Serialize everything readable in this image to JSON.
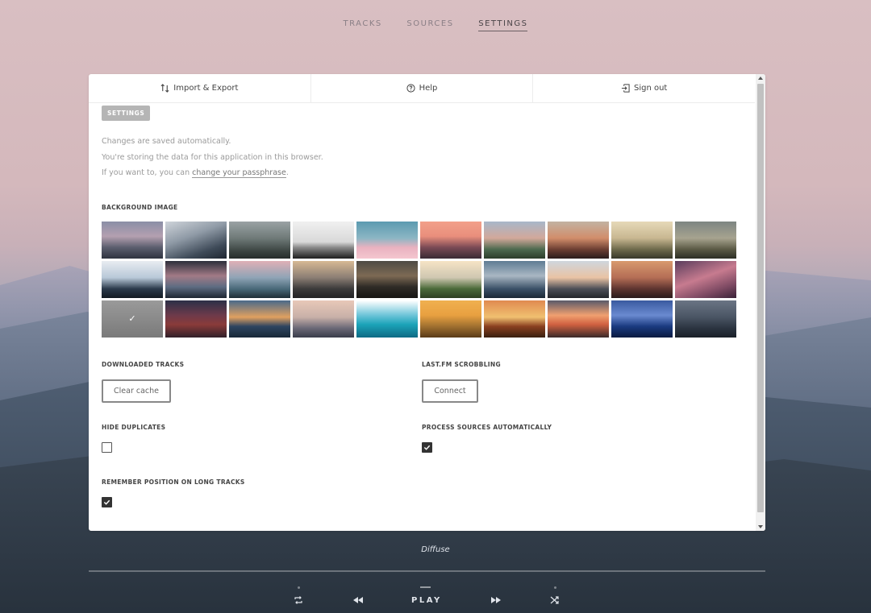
{
  "nav": {
    "tracks": "TRACKS",
    "sources": "SOURCES",
    "settings": "SETTINGS"
  },
  "panel": {
    "tabs": [
      {
        "label": "Import & Export",
        "icon": "import-export-icon"
      },
      {
        "label": "Help",
        "icon": "help-circle-icon"
      },
      {
        "label": "Sign out",
        "icon": "sign-out-icon"
      }
    ],
    "badge": "SETTINGS",
    "info_line1": "Changes are saved automatically.",
    "info_line2": "You're storing the data for this application in this browser.",
    "info_line3_prefix": "If you want to, you can ",
    "info_line3_link": "change your passphrase",
    "info_line3_suffix": "."
  },
  "background": {
    "label": "BACKGROUND IMAGE",
    "selected_index": 20,
    "thumbs": [
      "linear-gradient(180deg,#8a8ea6 0%,#b4a0b0 40%,#5b5e6e 70%,#2f3340 100%)",
      "linear-gradient(160deg,#cfd4da 0%,#8f9aa6 40%,#3e4a58 75%,#1f2731 100%)",
      "linear-gradient(180deg,#9aa2a4 0%,#6f7a78 45%,#3b4441 80%,#262d2b 100%)",
      "linear-gradient(180deg,#f0f0f0 0%,#d9d9d9 55%,#8a8a8a 70%,#1f1f1f 100%)",
      "linear-gradient(180deg,#5b9ab0 0%,#8cb6c4 45%,#e9b2c0 70%,#f4c6cf 100%)",
      "linear-gradient(180deg,#f2a08a 0%,#e98e7c 40%,#7a4a55 70%,#3a2a34 100%)",
      "linear-gradient(180deg,#a8b7c9 0%,#d2a89a 45%,#4d6a4f 75%,#2d3d2b 100%)",
      "linear-gradient(180deg,#c2b2a2 0%,#d18d6a 45%,#6d3f33 75%,#2b1d1c 100%)",
      "linear-gradient(180deg,#e6d9b8 0%,#c8b791 45%,#6e6a4c 75%,#38382a 100%)",
      "linear-gradient(180deg,#7d8582 0%,#a7a38f 45%,#5b5a45 75%,#2d2e25 100%)",
      "linear-gradient(180deg,#e8ecf1 0%,#b8c8d8 45%,#2b3a4b 75%,#121a22 100%)",
      "linear-gradient(180deg,#2c2f3b 0%,#a27a86 40%,#5e6c82 70%,#1d2631 100%)",
      "linear-gradient(180deg,#dfb0b6 0%,#8fa4b6 45%,#4a6a7a 75%,#1e2e36 100%)",
      "linear-gradient(180deg,#d7b994 0%,#8b7e74 45%,#3c3b3b 75%,#232324 100%)",
      "linear-gradient(180deg,#4e4a44 0%,#7d6a54 40%,#2f2b26 70%,#171512 100%)",
      "linear-gradient(180deg,#f6e4c6 0%,#cfc7b1 45%,#4b6a3a 75%,#2d3f22 100%)",
      "linear-gradient(180deg,#5f7c94 0%,#a9b7c3 40%,#3b5168 75%,#1b2836 100%)",
      "linear-gradient(180deg,#cfd6dd 0%,#e9c3a4 45%,#4c4f57 75%,#23252b 100%)",
      "linear-gradient(180deg,#d89a6e 0%,#b46d55 45%,#5e3530 75%,#2a1a1a 100%)",
      "linear-gradient(160deg,#5a3d5c 0%,#c77b8f 45%,#7e4a63 75%,#3a2238 100%)",
      "linear-gradient(180deg,#9a9a9a 0%,#8a8a8a 50%,#7a7a7a 100%)",
      "linear-gradient(180deg,#2c3048 0%,#6d3a4a 40%,#8a3b3a 65%,#31202a 100%)",
      "linear-gradient(180deg,#4a6a8a 0%,#e0a060 45%,#2e4560 70%,#182838 100%)",
      "linear-gradient(180deg,#e8c8b8 0%,#c8b0a8 45%,#6a6876 75%,#3a3c4a 100%)",
      "linear-gradient(180deg,#ffffff 0%,#6cc4d8 40%,#1ba3b8 65%,#0e6a84 100%)",
      "linear-gradient(180deg,#f0b050 0%,#e8a040 40%,#a07030 70%,#5a3a18 100%)",
      "linear-gradient(180deg,#e08a50 0%,#f0c070 45%,#8a4020 70%,#3a2010 100%)",
      "linear-gradient(180deg,#5a5a6a 0%,#f0a070 40%,#d06040 65%,#3a2a2a 100%)",
      "linear-gradient(180deg,#3a5aa0 0%,#6a8ad0 40%,#1a3a80 70%,#0a1a40 100%)",
      "linear-gradient(180deg,#6a7484 0%,#4a5564 45%,#2b3440 75%,#1a2028 100%)"
    ],
    "checkmark": "✓"
  },
  "options": {
    "downloaded_label": "DOWNLOADED TRACKS",
    "clear_cache": "Clear cache",
    "lastfm_label": "LAST.FM SCROBBLING",
    "connect": "Connect",
    "hide_dupes_label": "HIDE DUPLICATES",
    "hide_dupes_checked": false,
    "process_label": "PROCESS SOURCES AUTOMATICALLY",
    "process_checked": true,
    "remember_label": "REMEMBER POSITION ON LONG TRACKS",
    "remember_checked": true
  },
  "player": {
    "now_playing": "Diffuse",
    "play": "PLAY",
    "repeat_icon": "repeat-icon",
    "prev_icon": "rewind-icon",
    "next_icon": "fast-forward-icon",
    "shuffle_icon": "shuffle-icon"
  }
}
